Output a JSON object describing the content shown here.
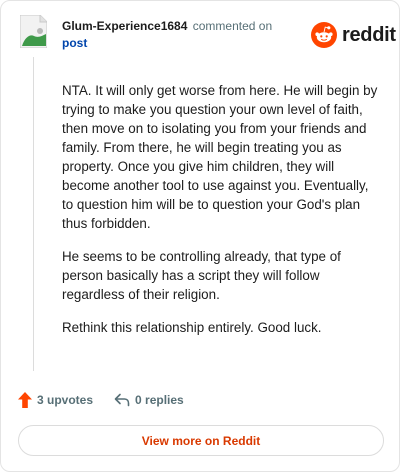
{
  "comment": {
    "author": "Glum-Experience1684",
    "action_text": "commented on",
    "target_link": "post",
    "paragraphs": [
      "NTA. It will only get worse from here. He will begin by trying to make you question your own level of faith, then move on to isolating you from your friends and family. From there, he will begin treating you as property. Once you give him children, they will become another tool to use against you. Eventually, to question him will be to question your God's plan thus forbidden.",
      "He seems to be controlling already, that type of person basically has a script they will follow regardless of their religion.",
      "Rethink this relationship entirely. Good luck."
    ],
    "upvotes_label": "3 upvotes",
    "replies_label": "0 replies"
  },
  "brand": {
    "wordmark": "reddit",
    "icon": "reddit-snoo-icon",
    "color": "#ff4500"
  },
  "footer": {
    "view_more_label": "View more on Reddit"
  },
  "colors": {
    "link": "#0045ac",
    "upvote": "#ff4500",
    "view_more": "#d93900",
    "muted": "#576f76"
  }
}
